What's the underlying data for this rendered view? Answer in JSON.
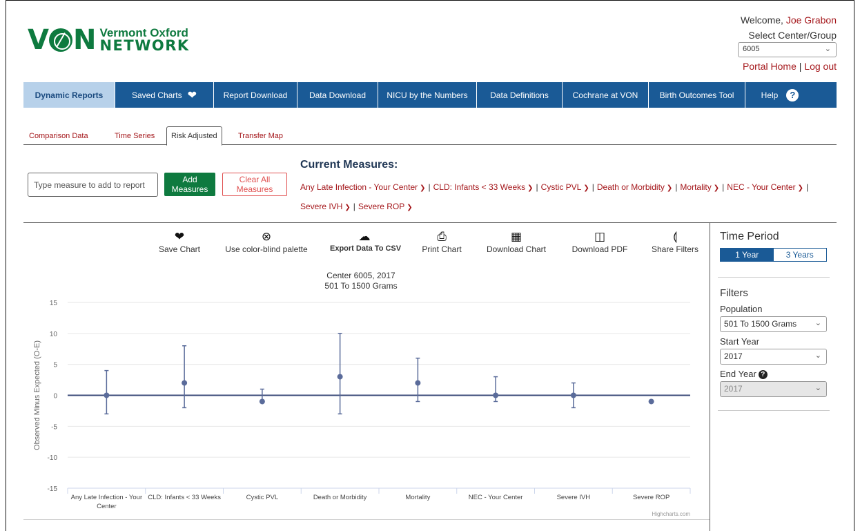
{
  "logo": {
    "mark": "VON",
    "line1": "Vermont Oxford",
    "line2": "NETWORK"
  },
  "header": {
    "welcome_prefix": "Welcome,",
    "user_name": "Joe Grabon",
    "select_center_label": "Select Center/Group",
    "center_value": "6005",
    "portal_home": "Portal Home",
    "divider": "|",
    "log_out": "Log out"
  },
  "nav": [
    {
      "label": "Dynamic Reports",
      "active": true
    },
    {
      "label": "Saved Charts",
      "icon": "heart-icon"
    },
    {
      "label": "Report Download"
    },
    {
      "label": "Data Download"
    },
    {
      "label": "NICU by the Numbers"
    },
    {
      "label": "Data Definitions"
    },
    {
      "label": "Cochrane at VON"
    },
    {
      "label": "Birth Outcomes Tool"
    },
    {
      "label": "Help",
      "icon": "help-icon"
    }
  ],
  "tabs": [
    {
      "label": "Comparison Data"
    },
    {
      "label": "Time Series"
    },
    {
      "label": "Risk Adjusted",
      "active": true
    },
    {
      "label": "Transfer Map"
    }
  ],
  "measure_input": {
    "placeholder": "Type measure to add to report"
  },
  "buttons": {
    "add_line1": "Add",
    "add_line2": "Measures",
    "clear_line1": "Clear All",
    "clear_line2": "Measures"
  },
  "current_measures": {
    "title": "Current Measures:",
    "items": [
      "Any Late Infection - Your Center",
      "CLD: Infants < 33 Weeks",
      "Cystic PVL",
      "Death or Morbidity",
      "Mortality",
      "NEC - Your Center",
      "Severe IVH",
      "Severe ROP"
    ]
  },
  "toolbar": [
    {
      "label": "Save Chart",
      "icon": "heart-icon"
    },
    {
      "label": "Use color-blind palette",
      "icon": "circle-x-icon"
    },
    {
      "label": "Export Data To CSV",
      "icon": "cloud-download-icon"
    },
    {
      "label": "Print Chart",
      "icon": "printer-icon"
    },
    {
      "label": "Download Chart",
      "icon": "bar-chart-icon"
    },
    {
      "label": "Download PDF",
      "icon": "pdf-icon"
    },
    {
      "label": "Share Filters",
      "icon": "share-icon"
    }
  ],
  "chart_data": {
    "type": "errorbar",
    "title": "Center 6005, 2017",
    "subtitle": "501 To 1500 Grams",
    "ylabel": "Observed Minus Expected (O-E)",
    "ylim": [
      -15,
      15
    ],
    "yticks": [
      15,
      10,
      5,
      0,
      -5,
      -10,
      -15
    ],
    "categories": [
      "Any Late Infection - Your Center",
      "CLD: Infants < 33 Weeks",
      "Cystic PVL",
      "Death or Morbidity",
      "Mortality",
      "NEC - Your Center",
      "Severe IVH",
      "Severe ROP"
    ],
    "values": [
      0,
      2,
      -1,
      3,
      2,
      0,
      0,
      -1
    ],
    "lower": [
      -3,
      -2,
      -1,
      -3,
      -1,
      -1,
      -2,
      -1
    ],
    "upper": [
      4,
      8,
      1,
      10,
      6,
      3,
      2,
      -1
    ],
    "grid": true,
    "credit": "Highcharts.com",
    "colors": {
      "series": "#5a6b9a",
      "zero_line": "#3a4a78",
      "grid": "#e6e6e6"
    }
  },
  "right_panel": {
    "time_period_title": "Time Period",
    "period_options": [
      "1 Year",
      "3 Years"
    ],
    "period_selected": "1 Year",
    "filters_title": "Filters",
    "population_label": "Population",
    "population_value": "501 To 1500 Grams",
    "start_year_label": "Start Year",
    "start_year_value": "2017",
    "end_year_label": "End Year",
    "end_year_value": "2017"
  },
  "colors": {
    "brand_green": "#0e7a3f",
    "nav_blue": "#1a5a96",
    "link_red": "#a4161a"
  }
}
